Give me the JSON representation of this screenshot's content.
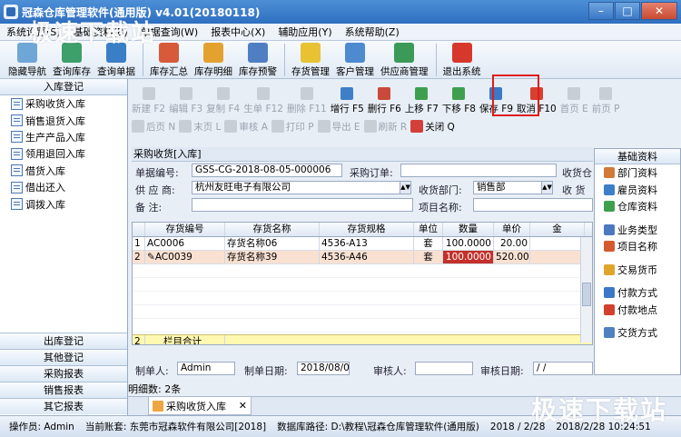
{
  "window": {
    "title": "冠森仓库管理软件(通用版) v4.01(20180118)"
  },
  "menu": [
    "系统设置(S)",
    "基础资料(B)",
    "单据查询(W)",
    "报表中心(X)",
    "辅助应用(Y)",
    "系统帮助(Z)"
  ],
  "toolbar": [
    {
      "label": "隐藏导航",
      "icon": "hide-nav-icon",
      "color": "#6fa6d8"
    },
    {
      "label": "查询库存",
      "icon": "query-stock-icon",
      "color": "#3d9f6a"
    },
    {
      "label": "查询单据",
      "icon": "query-doc-icon",
      "color": "#3a7fc6"
    },
    {
      "label": "库存汇总",
      "icon": "stock-summary-icon",
      "color": "#d75a3a"
    },
    {
      "label": "库存明细",
      "icon": "stock-detail-icon",
      "color": "#e3a22f"
    },
    {
      "label": "库存预警",
      "icon": "stock-warning-icon",
      "color": "#4f7fc2"
    },
    {
      "label": "存货管理",
      "icon": "inventory-icon",
      "color": "#e8c233"
    },
    {
      "label": "客户管理",
      "icon": "customer-icon",
      "color": "#4e8ad0"
    },
    {
      "label": "供应商管理",
      "icon": "supplier-icon",
      "color": "#3b9a57"
    },
    {
      "label": "退出系统",
      "icon": "exit-icon",
      "color": "#d6382c"
    }
  ],
  "left_panel": {
    "header": "入库登记",
    "items": [
      "采购收货入库",
      "销售退货入库",
      "生产产品入库",
      "领用退回入库",
      "借货入库",
      "借出还入",
      "调拨入库"
    ],
    "groups": [
      "出库登记",
      "其他登记",
      "采购报表",
      "销售报表",
      "其它报表"
    ]
  },
  "sub_toolbar": {
    "row1": [
      {
        "label": "新建 F2",
        "enabled": false,
        "color": "#9aa"
      },
      {
        "label": "编辑 F3",
        "enabled": false,
        "color": "#9aa"
      },
      {
        "label": "复制 F4",
        "enabled": false,
        "color": "#9aa"
      },
      {
        "label": "生单 F12",
        "enabled": false,
        "color": "#9aa"
      },
      {
        "label": "删除 F11",
        "enabled": false,
        "color": "#9aa"
      },
      {
        "label": "增行 F5",
        "enabled": true,
        "color": "#3f7fc8"
      },
      {
        "label": "删行 F6",
        "enabled": true,
        "color": "#c94a3a"
      },
      {
        "label": "上移 F7",
        "enabled": true,
        "color": "#3ea04f"
      },
      {
        "label": "下移 F8",
        "enabled": true,
        "color": "#3ea04f"
      },
      {
        "label": "保存 F9",
        "enabled": true,
        "color": "#3c78c5"
      },
      {
        "label": "取消 F10",
        "enabled": true,
        "color": "#d8402e"
      },
      {
        "label": "首页 E",
        "enabled": false,
        "color": "#9aa"
      },
      {
        "label": "前页 P",
        "enabled": false,
        "color": "#9aa"
      }
    ],
    "row2": [
      {
        "label": "后页 N",
        "enabled": false
      },
      {
        "label": "末页 L",
        "enabled": false
      },
      {
        "label": "审核 A",
        "enabled": false
      },
      {
        "label": "打印 P",
        "enabled": false
      },
      {
        "label": "导出 E",
        "enabled": false
      },
      {
        "label": "刷新 R",
        "enabled": false
      },
      {
        "label": "关闭 Q",
        "enabled": true
      }
    ]
  },
  "form": {
    "title": "采购收货[入库]",
    "doc_no_label": "单据编号:",
    "doc_no": "GSS-CG-2018-08-05-000006",
    "order_label": "采购订单:",
    "order": "",
    "warehouse_label": "收货仓",
    "supplier_label": "供 应 商:",
    "supplier": "杭州友旺电子有限公司",
    "dept_label": "收货部门:",
    "dept": "销售部",
    "receive_label": "收 货",
    "note_label": "备    注:",
    "note": "",
    "project_label": "项目名称:",
    "project": ""
  },
  "grid": {
    "columns": [
      "存货编号",
      "存货名称",
      "存货规格",
      "单位",
      "数量",
      "单价",
      "金"
    ],
    "rows": [
      {
        "no": "1",
        "code": "AC0006",
        "name": "存货名称06",
        "spec": "4536-A13",
        "unit": "套",
        "qty": "100.0000",
        "price": "20.00"
      },
      {
        "no": "2",
        "code": "AC0039",
        "name": "存货名称39",
        "spec": "4536-A46",
        "unit": "套",
        "qty": "100.0000",
        "price": "520.00"
      }
    ],
    "total_no": "2",
    "total_label": "栏目合计"
  },
  "footer_form": {
    "maker_label": "制单人:",
    "maker": "Admin",
    "date_label": "制单日期:",
    "date": "2018/08/05",
    "reviewer_label": "审核人:",
    "reviewer": "",
    "review_date_label": "审核日期:",
    "review_date": "/ /",
    "detail_count": "明细数: 2条"
  },
  "right_panel": {
    "header": "基础资料",
    "items": [
      {
        "label": "部门资料",
        "color": "#d27a3a"
      },
      {
        "label": "雇员资料",
        "color": "#3d7fc8"
      },
      {
        "label": "仓库资料",
        "color": "#3ea04f"
      },
      {
        "label": "业务类型",
        "color": "#4d78c0"
      },
      {
        "label": "项目名称",
        "color": "#d45a30"
      },
      {
        "label": "交易货币",
        "color": "#e0a62c"
      },
      {
        "label": "付款方式",
        "color": "#3c78c5"
      },
      {
        "label": "付款地点",
        "color": "#d4402f"
      },
      {
        "label": "交货方式",
        "color": "#5080c0"
      }
    ]
  },
  "doc_tab": {
    "label": "采购收货入库"
  },
  "statusbar": {
    "operator": "操作员: Admin",
    "account": "当前账套: 东莞市冠森软件有限公司[2018]",
    "db_path": "数据库路径: D:\\教程\\冠森仓库管理软件(通用版)",
    "date_info": "2018 / 2/28",
    "datetime": "2018/2/28 10:24:51"
  },
  "watermarks": [
    "极速下载站",
    "极速下载站"
  ]
}
